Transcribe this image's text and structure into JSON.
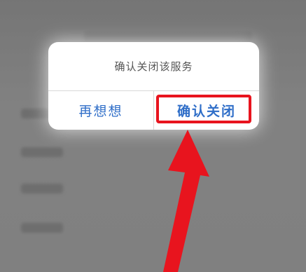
{
  "dialog": {
    "message": "确认关闭该服务",
    "cancel_label": "再想想",
    "confirm_label": "确认关闭"
  },
  "colors": {
    "accent": "#2f6ec8",
    "highlight": "#e8141e"
  }
}
